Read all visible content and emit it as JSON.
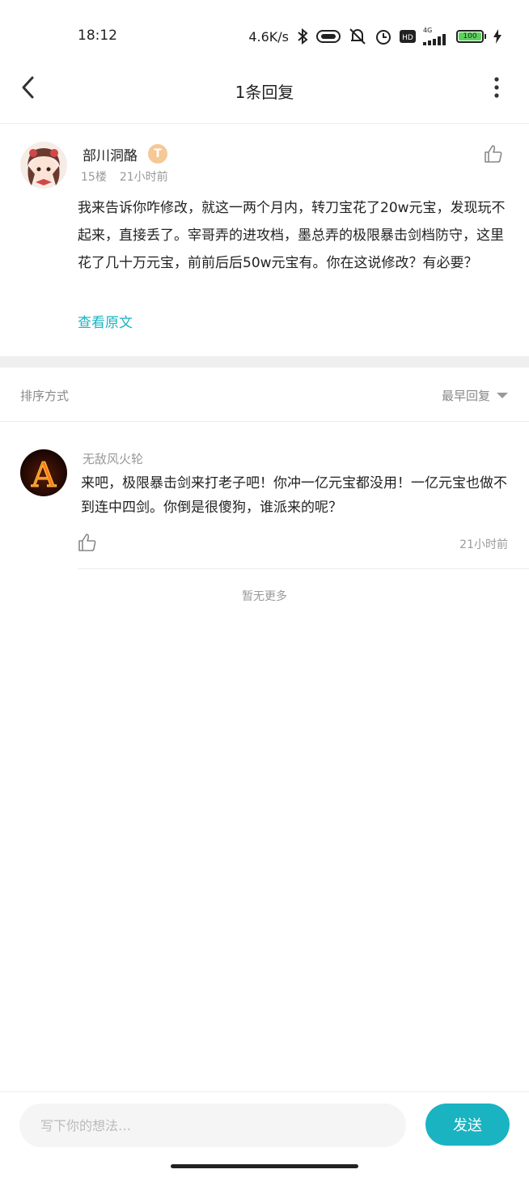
{
  "status_bar": {
    "time": "18:12",
    "network_speed": "4.6K/s",
    "signal_label": "4G",
    "battery_level": "100",
    "icons": [
      "bluetooth-icon",
      "vpn-icon",
      "mute-icon",
      "alarm-icon",
      "hd-icon",
      "signal-icon",
      "battery-icon",
      "charging-icon"
    ]
  },
  "header": {
    "title": "1条回复",
    "back_icon": "chevron-left-icon",
    "more_icon": "more-vertical-icon"
  },
  "main_comment": {
    "author": "部川洞酪",
    "level_badge": "T",
    "floor": "15楼",
    "time": "21小时前",
    "text": "我来告诉你咋修改，就这一两个月内，转刀宝花了20w元宝，发现玩不起来，直接丢了。宰哥弄的进攻档，墨总弄的极限暴击剑档防守，这里花了几十万元宝，前前后后50w元宝有。你在这说修改？有必要？",
    "view_original": "查看原文",
    "like_icon": "thumbs-up-icon"
  },
  "sort": {
    "label": "排序方式",
    "selected": "最早回复"
  },
  "replies": [
    {
      "author": "无敌风火轮",
      "avatar_letter": "A",
      "text": "来吧，极限暴击剑来打老子吧！你冲一亿元宝都没用！一亿元宝也做不到连中四剑。你倒是很傻狗，谁派来的呢？",
      "time": "21小时前"
    }
  ],
  "footer_note": "暂无更多",
  "composer": {
    "placeholder": "写下你的想法…",
    "send_label": "发送"
  },
  "colors": {
    "accent": "#1ab3c2",
    "badge": "#f5c896"
  }
}
